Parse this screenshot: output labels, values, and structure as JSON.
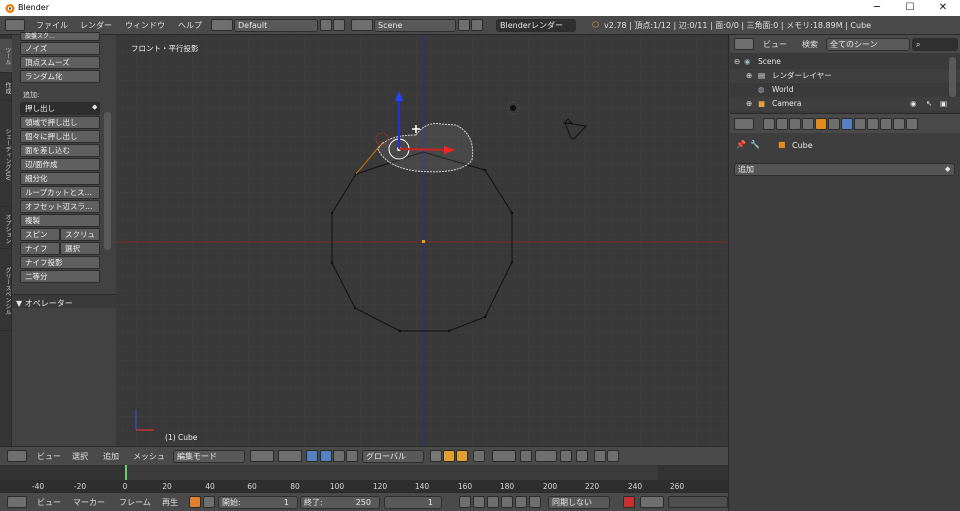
{
  "window": {
    "title": "Blender",
    "minimize": "─",
    "maximize": "☐",
    "close": "✕"
  },
  "infobar": {
    "menus": [
      "ファイル",
      "レンダー",
      "ウィンドウ",
      "ヘルプ"
    ],
    "layout": "Default",
    "scene": "Scene",
    "engine": "Blenderレンダー",
    "stats": "v2.78 | 頂点:1/12 | 辺:0/11 | 面:0/0 | 三角面:0 | メモリ:18.89M | Cube"
  },
  "toolshelf": {
    "tabs": [
      "ツール",
      "作成",
      "シェーディング/UV",
      "オプション",
      "グリースペンシル"
    ],
    "top_items": [
      "旋盤スク…",
      "ノイズ",
      "頂点スムーズ",
      "ランダム化"
    ],
    "add_label": "追加:",
    "extrude": "押し出し",
    "items": [
      "領域で押し出し",
      "個々に押し出し",
      "面を差し込む",
      "辺/面作成",
      "細分化",
      "ループカットとス…",
      "オフセット辺スラ…",
      "複製"
    ],
    "spin": "スピン",
    "screw": "スクリュ",
    "knife": "ナイフ",
    "select": "選択",
    "knife_project": "ナイフ投影",
    "bisect": "二等分",
    "operator": "▼ オペレーター"
  },
  "viewport": {
    "view_label": "フロント・平行投影",
    "object_label": "(1) Cube"
  },
  "vheader": {
    "menus": [
      "ビュー",
      "選択",
      "追加",
      "メッシュ"
    ],
    "mode": "編集モード",
    "orientation": "グローバル"
  },
  "timeline": {
    "ticks": [
      "-40",
      "-20",
      "0",
      "20",
      "40",
      "60",
      "80",
      "100",
      "120",
      "140",
      "160",
      "180",
      "200",
      "220",
      "240",
      "260"
    ]
  },
  "tlheader": {
    "menus": [
      "ビュー",
      "マーカー",
      "フレーム",
      "再生"
    ],
    "start_label": "開始:",
    "start": "1",
    "end_label": "終了:",
    "end": "250",
    "current": "1",
    "sync": "同期しない"
  },
  "outliner": {
    "menus": [
      "ビュー",
      "検索"
    ],
    "filter": "全てのシーン",
    "rows": [
      "Scene",
      "レンダーレイヤー",
      "World",
      "Camera"
    ]
  },
  "props": {
    "breadcrumb": "Cube",
    "add_modifier": "追加"
  }
}
